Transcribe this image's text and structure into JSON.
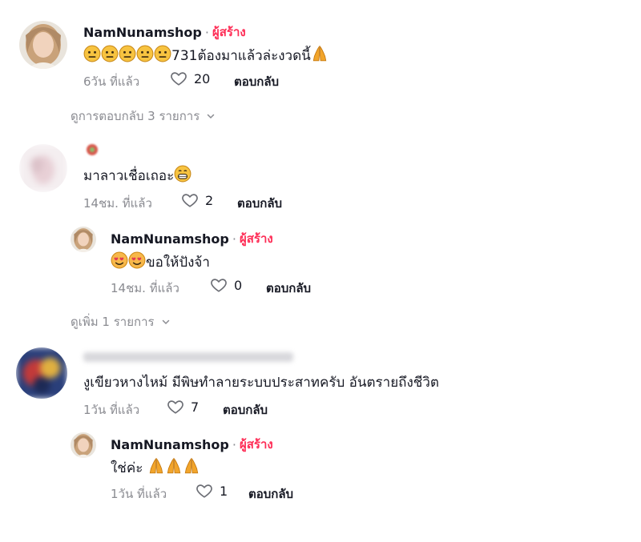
{
  "comments": [
    {
      "author": "NamNunamshop",
      "separator": "·",
      "creator_label": "ผู้สร้าง",
      "text": "731ต้องมาแล้วล่ะงวดนี้",
      "time": "6วัน ที่แล้ว",
      "likes": "20",
      "reply_label": "ตอบกลับ",
      "view_replies": "ดูการตอบกลับ 3 รายการ"
    },
    {
      "author": "",
      "text": "มาลาวเชื่อเถอะ",
      "time": "14ชม. ที่แล้ว",
      "likes": "2",
      "reply_label": "ตอบกลับ",
      "replies": [
        {
          "author": "NamNunamshop",
          "separator": "·",
          "creator_label": "ผู้สร้าง",
          "text": "ขอให้ปังจ้า",
          "time": "14ชม. ที่แล้ว",
          "likes": "0",
          "reply_label": "ตอบกลับ"
        }
      ],
      "view_more": "ดูเพิ่ม 1 รายการ"
    },
    {
      "author": "",
      "text": "งูเขียวหางไหม้ มีพิษทำลายระบบประสาทครับ อันตรายถึงชีวิต",
      "time": "1วัน ที่แล้ว",
      "likes": "7",
      "reply_label": "ตอบกลับ",
      "replies": [
        {
          "author": "NamNunamshop",
          "separator": "·",
          "creator_label": "ผู้สร้าง",
          "text": "ใช่ค่ะ",
          "time": "1วัน ที่แล้ว",
          "likes": "1",
          "reply_label": "ตอบกลับ"
        }
      ]
    }
  ],
  "colors": {
    "creator": "#fe2c55",
    "muted": "#8a8b91",
    "text": "#161823"
  },
  "icons": [
    "heart-outline-icon",
    "chevron-down-icon",
    "neutral-face-emoji",
    "folded-hands-emoji",
    "smiling-hearts-emoji",
    "grinning-emoji"
  ]
}
